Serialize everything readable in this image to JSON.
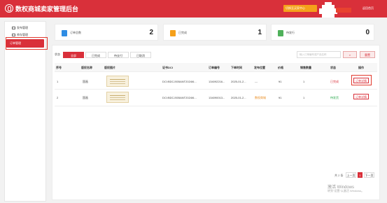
{
  "header": {
    "title": "数权商城卖家管理后台",
    "action_button": "切换至买家中心",
    "link": "返回首页",
    "colors": {
      "bar": "#d9303a",
      "button": "#f5a01a"
    }
  },
  "sidebar": {
    "items": [
      {
        "label": "发布管理",
        "icon": "send-icon"
      },
      {
        "label": "库存管理",
        "icon": "box-icon"
      },
      {
        "label": "订单管理",
        "icon": "order-icon",
        "active": true
      }
    ]
  },
  "stats": [
    {
      "label": "订单总数",
      "value": "2",
      "icon": "order-total-icon",
      "color": "#2f8de4"
    },
    {
      "label": "已完成",
      "value": "1",
      "icon": "completed-icon",
      "color": "#f5a01a"
    },
    {
      "label": "待发行",
      "value": "0",
      "icon": "pending-icon",
      "color": "#4fb05a"
    }
  ],
  "filter": {
    "status_label": "状态",
    "tabs": [
      "全部",
      "已完成",
      "待支付",
      "已取消"
    ],
    "active_tab": "全部",
    "search_placeholder": "输入订单编号或产品名称",
    "search_icon": "search-icon",
    "reset_label": "重置"
  },
  "table": {
    "headers": [
      "序号",
      "版权名称",
      "版权图片",
      "证书DCI",
      "订单编号",
      "下单时间",
      "发布位置",
      "价格",
      "销售数量",
      "状态",
      "操作"
    ],
    "rows": [
      {
        "index": "1",
        "name": "国画",
        "dci": "DCI:BDCJ005ANT2024I6...",
        "order_no": "134092216...",
        "time": "2025-01-2...",
        "position": "---",
        "price": "¥1",
        "qty": "1",
        "status": "已完成",
        "status_color": "#d9303a",
        "action": "订单详情"
      },
      {
        "index": "2",
        "name": "国画",
        "dci": "DCI:BDCJ005ANT2024I6...",
        "order_no": "134090013...",
        "time": "2025-01-2...",
        "position": "数权商城",
        "price": "¥1",
        "qty": "1",
        "status": "待发货",
        "status_color": "#27a84a",
        "action": "订单详情"
      }
    ]
  },
  "pagination": {
    "total": "共 2 条",
    "prev": "上一页",
    "page": "1",
    "next": "下一页"
  },
  "watermark": {
    "line1": "激活 Windows",
    "line2": "转到\"设置\"以激活 Windows。"
  }
}
